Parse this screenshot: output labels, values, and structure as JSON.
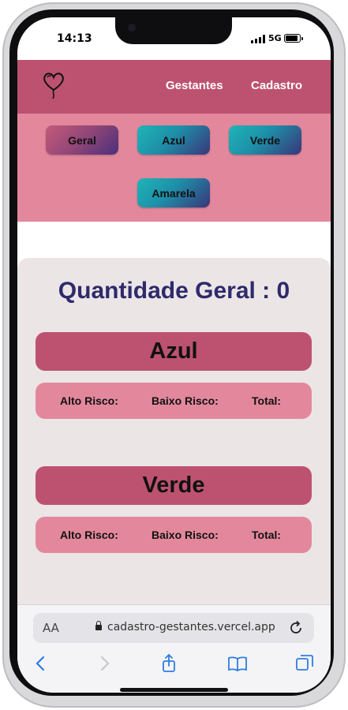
{
  "status_bar": {
    "time": "14:13",
    "network": "5G"
  },
  "header": {
    "nav": [
      "Gestantes",
      "Cadastro"
    ]
  },
  "filters": {
    "buttons": [
      "Geral",
      "Azul",
      "Verde",
      "Amarela"
    ]
  },
  "summary": {
    "title": "Quantidade Geral : 0"
  },
  "groups": [
    {
      "name": "Azul",
      "high_risk_label": "Alto Risco:",
      "low_risk_label": "Baixo Risco:",
      "total_label": "Total:"
    },
    {
      "name": "Verde",
      "high_risk_label": "Alto Risco:",
      "low_risk_label": "Baixo Risco:",
      "total_label": "Total:"
    }
  ],
  "browser": {
    "text_size": "AA",
    "url": "cadastro-gestantes.vercel.app"
  },
  "colors": {
    "header": "#bd5270",
    "band": "#e3889c",
    "title": "#2e2a6b",
    "card": "#ebe5e6"
  },
  "icons": [
    "heart-balloon-logo-icon",
    "signal-icon",
    "battery-icon",
    "lock-icon",
    "reload-icon",
    "back-icon",
    "forward-icon",
    "share-icon",
    "bookmarks-icon",
    "tabs-icon"
  ]
}
